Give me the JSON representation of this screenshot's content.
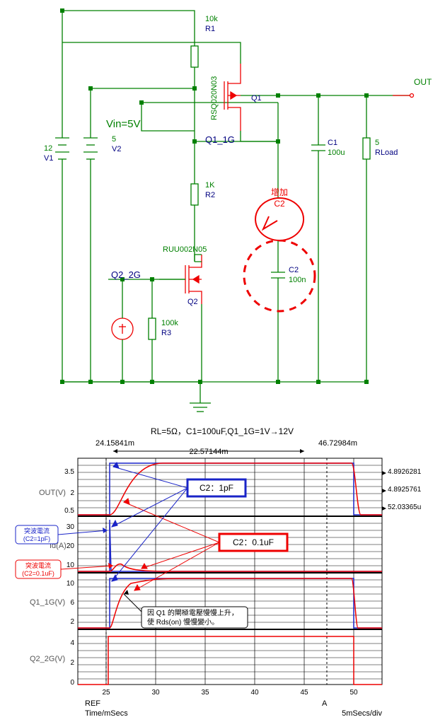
{
  "schematic": {
    "V1": {
      "val": "12",
      "name": "V1"
    },
    "V2": {
      "val": "5",
      "name": "V2"
    },
    "Vin": "Vin=5V",
    "R1": {
      "val": "10k",
      "name": "R1"
    },
    "R2": {
      "val": "1K",
      "name": "R2"
    },
    "R3": {
      "val": "100k",
      "name": "R3"
    },
    "RLoad": {
      "val": "5",
      "name": "RLoad"
    },
    "C1": {
      "val": "100u",
      "name": "C1"
    },
    "C2": {
      "val": "100n",
      "name": "C2"
    },
    "Q1": {
      "model": "RSQ020N03",
      "name": "Q1"
    },
    "Q2": {
      "model": "RUU002N05",
      "name": "Q2"
    },
    "Q1_1G": "Q1_1G",
    "Q2_2G": "Q2_2G",
    "OUT": "OUT",
    "callout": {
      "l1": "增加",
      "l2": "C2"
    }
  },
  "plot": {
    "title": "RL=5Ω，C1=100uF,Q1_1G=1V→12V",
    "marker_left": "24.15841m",
    "marker_span": "22.57144m",
    "marker_right": "46.72984m",
    "axes": {
      "OUT": "OUT(V)",
      "Id": "Id(A)",
      "Q1": "Q1_1G(V)",
      "Q2": "Q2_2G(V)"
    },
    "yticks": {
      "OUT": [
        "3.5",
        "2",
        "0.5"
      ],
      "Id": [
        "30",
        "20",
        "10"
      ],
      "Q1": [
        "10",
        "6",
        "2"
      ],
      "Q2": [
        "4",
        "2",
        "0"
      ]
    },
    "xticks": [
      "25",
      "30",
      "35",
      "40",
      "45",
      "50"
    ],
    "right": [
      "4.8926281",
      "4.8925761",
      "52.03365u"
    ],
    "ref": "REF",
    "a": "A",
    "xlabel": "Time/mSecs",
    "xdiv": "5mSecs/div",
    "boxC2a": "C2：1pF",
    "boxC2b": "C2：0.1uF",
    "note": {
      "l1": "因 Q1 的閘極電壓慢慢上升，",
      "l2": "使 Rds(on) 慢慢變小。"
    },
    "surge_blue": {
      "l1": "突波電流",
      "l2": "(C2=1pF)"
    },
    "surge_red": {
      "l1": "突波電流",
      "l2": "(C2=0.1uF)"
    }
  }
}
